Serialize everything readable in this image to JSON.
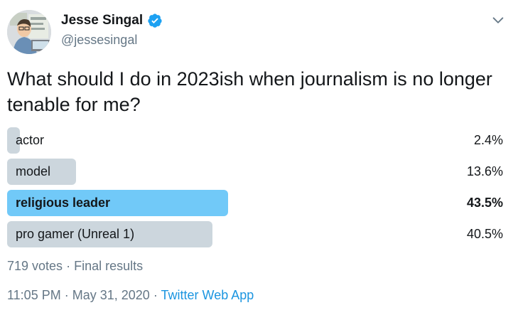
{
  "author": {
    "display_name": "Jesse Singal",
    "handle": "@jessesingal",
    "verified": true
  },
  "tweet": {
    "text": "What should I do in 2023ish when journalism is no longer tenable for me?"
  },
  "poll": {
    "options": [
      {
        "label": "actor",
        "percent_text": "2.4%",
        "percent": 2.4,
        "winner": false
      },
      {
        "label": "model",
        "percent_text": "13.6%",
        "percent": 13.6,
        "winner": false
      },
      {
        "label": "religious leader",
        "percent_text": "43.5%",
        "percent": 43.5,
        "winner": true
      },
      {
        "label": "pro gamer (Unreal 1)",
        "percent_text": "40.5%",
        "percent": 40.5,
        "winner": false
      }
    ],
    "votes": "719 votes",
    "separator": "·",
    "status": "Final results"
  },
  "footer": {
    "time": "11:05 PM",
    "separator": "·",
    "date": "May 31, 2020",
    "source": "Twitter Web App"
  },
  "colors": {
    "bar": "#ccd6dd",
    "winner_bar": "#71c9f8",
    "verified": "#1da1f2",
    "link": "#1b95e0",
    "secondary_text": "#657786"
  },
  "icons": {
    "verified": "verified-badge-icon",
    "menu": "chevron-down-icon"
  }
}
